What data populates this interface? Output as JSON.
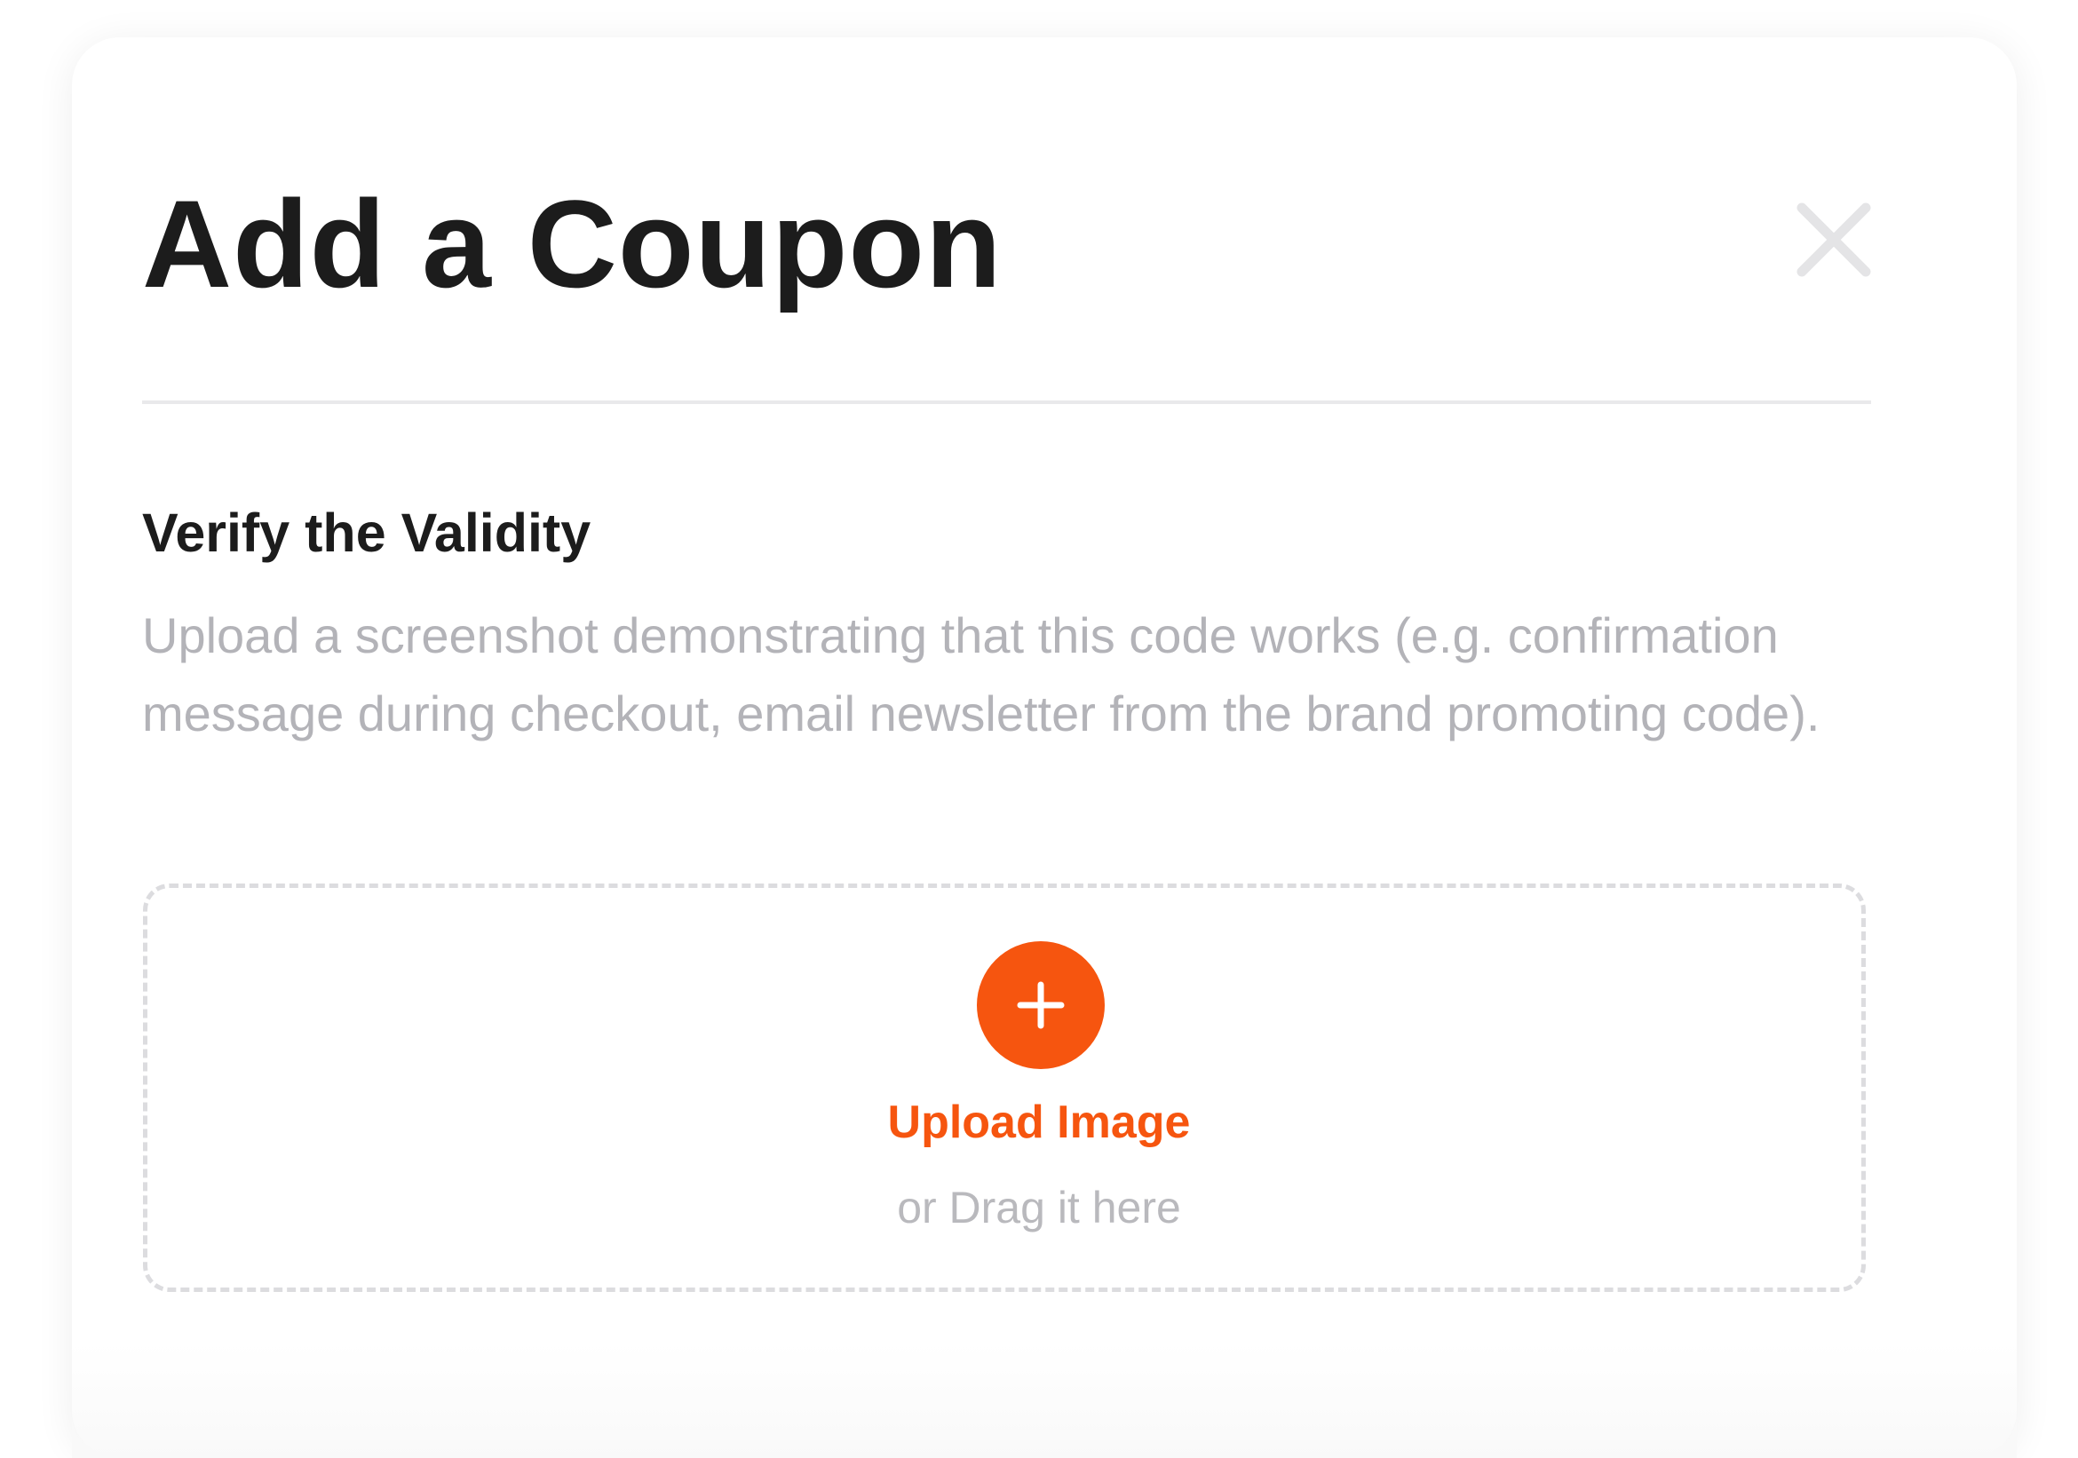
{
  "modal": {
    "title": "Add a Coupon",
    "close_icon": "close-icon"
  },
  "verify_section": {
    "title": "Verify the Validity",
    "description": "Upload a screenshot demonstrating that this code works (e.g. confirmation message during checkout, email newsletter from the brand promoting code)."
  },
  "upload": {
    "icon": "plus-icon",
    "label": "Upload Image",
    "hint": "or Drag it here"
  },
  "colors": {
    "accent": "#f6550f",
    "title_text": "#1c1c1c",
    "muted_text": "#b3b3b8",
    "close_icon": "#e4e4e6",
    "divider": "#e9e9eb",
    "dropzone_border": "#dcdcdf"
  }
}
